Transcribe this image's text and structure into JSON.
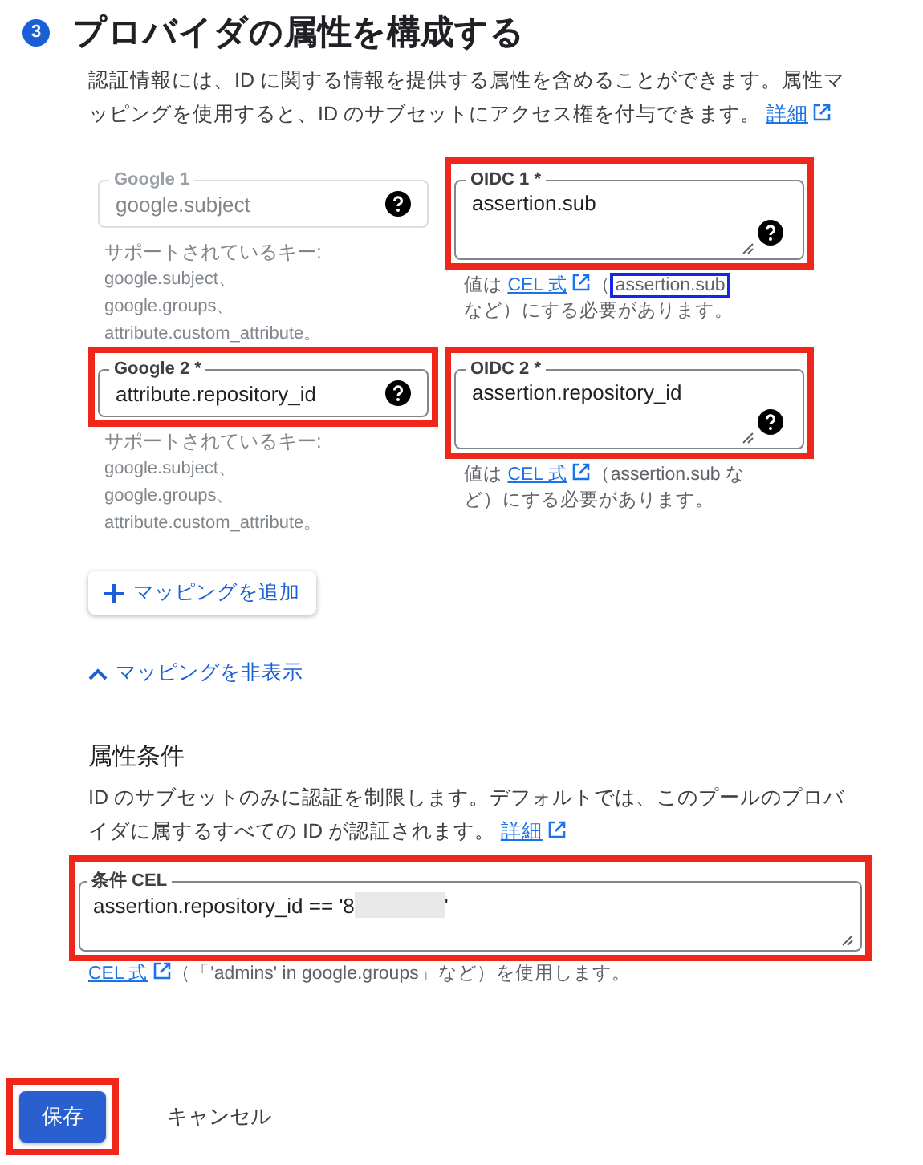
{
  "step": {
    "number": "3",
    "title": "プロバイダの属性を構成する",
    "description": "認証情報には、ID に関する情報を提供する属性を含めることができます。属性マッピングを使用すると、ID のサブセットにアクセス権を付与できます。",
    "link": "詳細"
  },
  "mappings": [
    {
      "google": {
        "label": "Google 1",
        "value": "google.subject",
        "disabled": true,
        "highlighted": false,
        "hint_lines": [
          "サポートされているキー:",
          "google.subject、",
          "google.groups、",
          "attribute.custom_attribute。"
        ]
      },
      "oidc": {
        "label": "OIDC 1 *",
        "value": "assertion.sub",
        "highlighted": true,
        "hint_prefix": "値は",
        "hint_link": "CEL 式",
        "hint_open": "（",
        "hint_code": "assertion.sub",
        "code_highlighted": true,
        "hint_tail": "など）にする必要があります。"
      }
    },
    {
      "google": {
        "label": "Google 2 *",
        "value": "attribute.repository_id",
        "disabled": false,
        "highlighted": true,
        "hint_lines": [
          "サポートされているキー:",
          "google.subject、",
          "google.groups、",
          "attribute.custom_attribute。"
        ]
      },
      "oidc": {
        "label": "OIDC 2 *",
        "value": "assertion.repository_id",
        "highlighted": true,
        "hint_prefix": "値は",
        "hint_link": "CEL 式",
        "hint_open": "（",
        "hint_code": "assertion.sub",
        "code_highlighted": false,
        "hint_tail": "など）にする必要があります。"
      }
    }
  ],
  "add_mapping": {
    "label": "マッピングを追加"
  },
  "toggle_mappings": {
    "label": "マッピングを非表示",
    "expanded": true
  },
  "condition": {
    "heading": "属性条件",
    "description": "ID のサブセットのみに認証を制限します。デフォルトでは、このプールのプロバイダに属するすべての ID が認証されます。",
    "link": "詳細",
    "field_label": "条件 CEL",
    "value_start": "assertion.repository_id == '8",
    "value_end": "'",
    "redacted": true,
    "highlighted": true,
    "hint_link": "CEL 式",
    "hint_text": "（「'admins' in google.groups」など）を使用します。"
  },
  "buttons": [
    {
      "label": "保存",
      "kind": "primary",
      "highlighted": true
    },
    {
      "label": "キャンセル",
      "kind": "text",
      "highlighted": false
    }
  ]
}
